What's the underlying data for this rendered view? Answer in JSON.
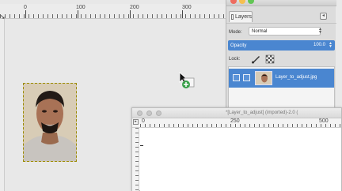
{
  "main_window": {
    "ruler_labels": [
      "0",
      "100",
      "200",
      "300"
    ]
  },
  "layers_dock": {
    "tab_label": "Layers",
    "tab_menu_glyph": "◂",
    "mode_label": "Mode:",
    "mode_value": "Normal",
    "opacity_label": "Opacity",
    "opacity_value": "100.0",
    "lock_label": "Lock:",
    "layer_name": "Layer_to_adjust.jpg"
  },
  "image_window": {
    "title": "*[Layer_to_adjust] (imported)-2.0 (",
    "ruler_labels": [
      "0",
      "250",
      "500"
    ]
  },
  "colors": {
    "accent": "#4a86d0",
    "selection_border": "#9a8b00"
  },
  "icons": [
    "layers-tab-icon",
    "tab-menu-icon",
    "lock-pixels-icon",
    "lock-alpha-icon",
    "eye-icon",
    "chain-icon",
    "drag-copy-cursor-icon"
  ]
}
